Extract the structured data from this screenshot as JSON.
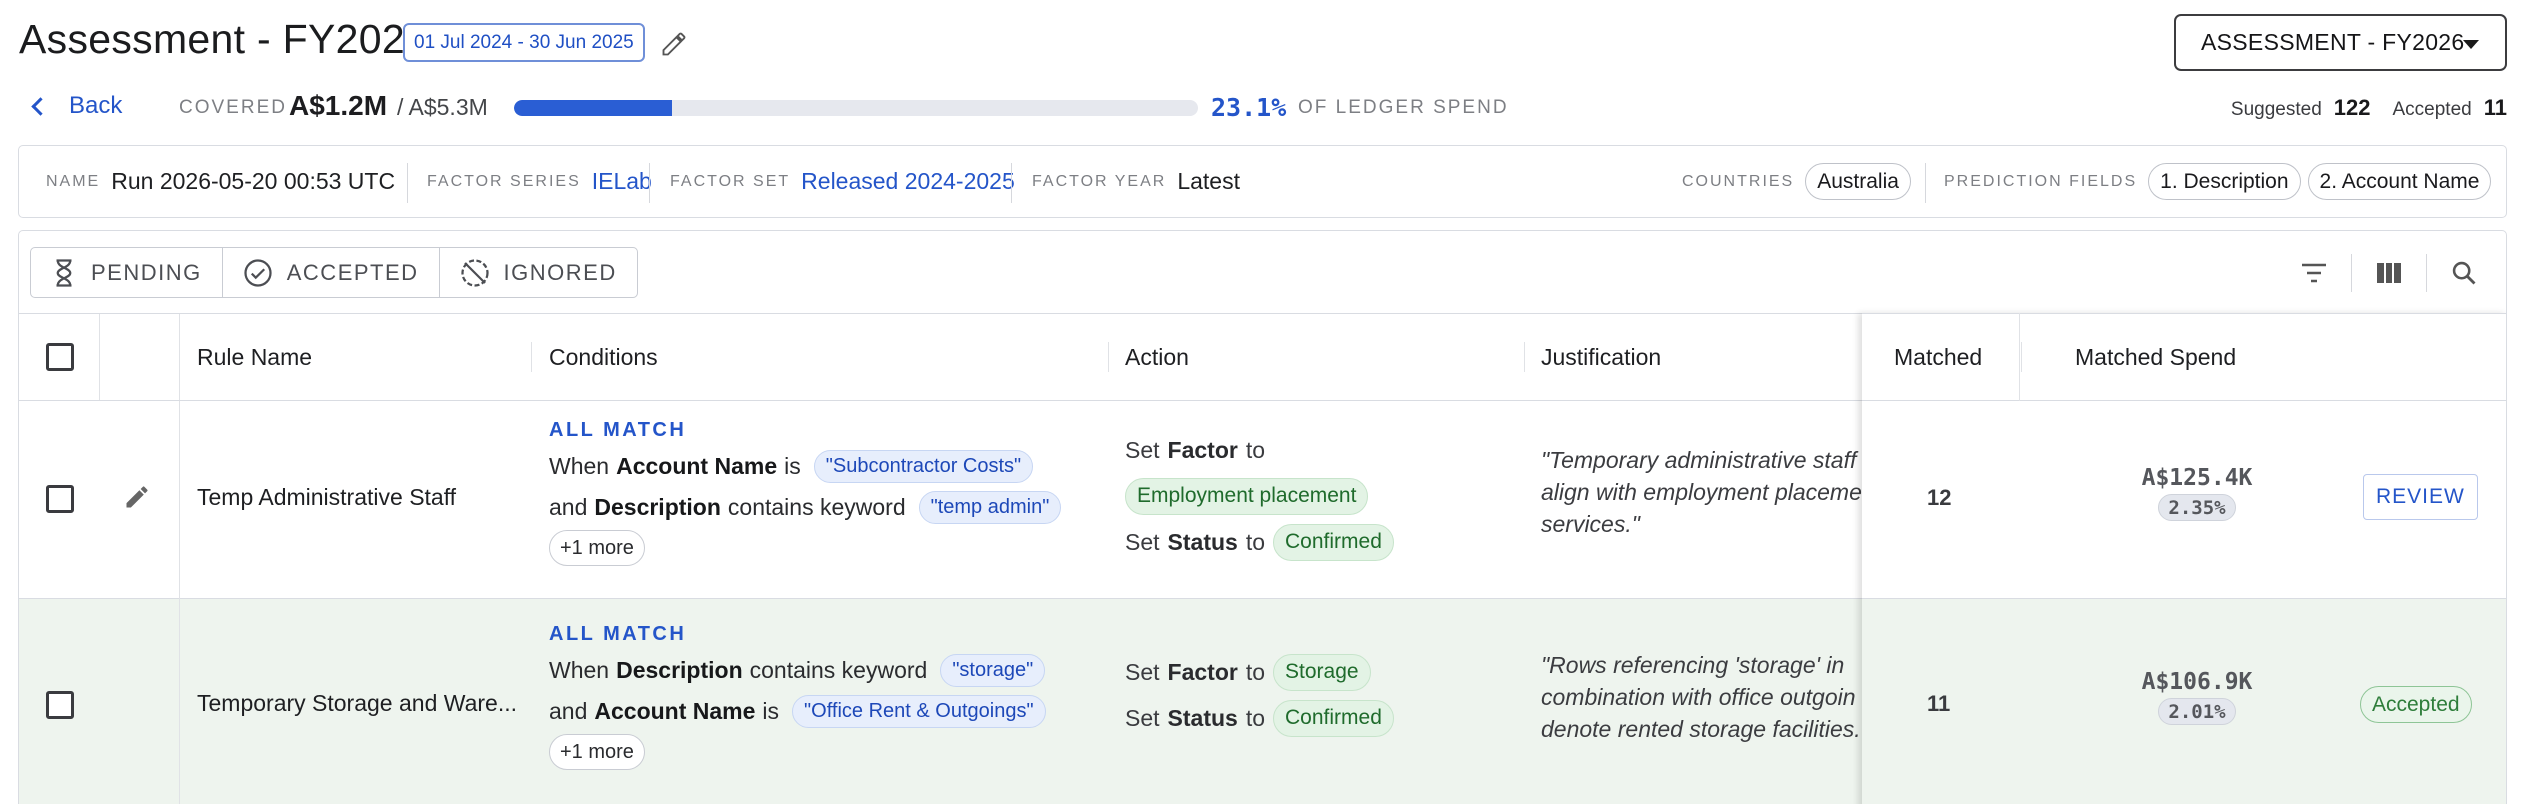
{
  "header": {
    "title": "Assessment - FY2026",
    "date_range": "01 Jul 2024 - 30 Jun 2025",
    "assessment_select": "ASSESSMENT - FY2026"
  },
  "summary": {
    "back_label": "Back",
    "covered_label": "COVERED",
    "covered_value": "A$1.2M",
    "covered_total": "/ A$5.3M",
    "progress_fraction": 0.231,
    "progress_color": "#2a5ed4",
    "percent": "23.1%",
    "percent_label": "OF LEDGER SPEND",
    "suggested_label": "Suggested",
    "suggested_count": "122",
    "accepted_label": "Accepted",
    "accepted_count": "11"
  },
  "run_info": {
    "name_label": "NAME",
    "name_value": "Run 2026-05-20 00:53 UTC",
    "factor_series_label": "FACTOR SERIES",
    "factor_series_value": "IELab",
    "factor_set_label": "FACTOR SET",
    "factor_set_value": "Released 2024-2025",
    "factor_year_label": "FACTOR YEAR",
    "factor_year_value": "Latest",
    "countries_label": "COUNTRIES",
    "countries": [
      "Australia"
    ],
    "prediction_fields_label": "PREDICTION FIELDS",
    "prediction_fields": [
      "1. Description",
      "2. Account Name"
    ]
  },
  "filter_tabs": [
    {
      "label": "PENDING",
      "icon": "hourglass-icon"
    },
    {
      "label": "ACCEPTED",
      "icon": "check-circle-icon"
    },
    {
      "label": "IGNORED",
      "icon": "ignore-circle-icon"
    }
  ],
  "toolbar": {
    "icons": [
      "filter-icon",
      "columns-icon",
      "search-icon"
    ]
  },
  "table": {
    "columns": [
      "Rule Name",
      "Conditions",
      "Action",
      "Justification",
      "Matched",
      "Matched Spend"
    ],
    "rows": [
      {
        "rule_name": "Temp Administrative Staff",
        "match_mode": "ALL MATCH",
        "conditions": [
          {
            "prefix": "When",
            "field": "Account Name",
            "op": "is",
            "value": "\"Subcontractor Costs\""
          },
          {
            "prefix": "and",
            "field": "Description",
            "op": "contains keyword",
            "value": "\"temp admin\""
          }
        ],
        "more": "+1 more",
        "actions": [
          {
            "prefix": "Set",
            "field": "Factor",
            "to": "to",
            "value": "Employment placement"
          },
          {
            "prefix": "Set",
            "field": "Status",
            "to": "to",
            "value": "Confirmed"
          }
        ],
        "justification": [
          "\"Temporary administrative staff",
          "align with employment placeme",
          "services.\""
        ],
        "matched": "12",
        "matched_spend": "A$125.4K",
        "spend_pct": "2.35%",
        "status_action": "REVIEW"
      },
      {
        "rule_name": "Temporary Storage and Ware...",
        "match_mode": "ALL MATCH",
        "conditions": [
          {
            "prefix": "When",
            "field": "Description",
            "op": "contains keyword",
            "value": "\"storage\""
          },
          {
            "prefix": "and",
            "field": "Account Name",
            "op": "is",
            "value": "\"Office Rent & Outgoings\""
          }
        ],
        "more": "+1 more",
        "actions": [
          {
            "prefix": "Set",
            "field": "Factor",
            "to": "to",
            "value": "Storage"
          },
          {
            "prefix": "Set",
            "field": "Status",
            "to": "to",
            "value": "Confirmed"
          }
        ],
        "justification": [
          "\"Rows referencing 'storage' in",
          "combination with office outgoin",
          "denote rented storage facilities."
        ],
        "matched": "11",
        "matched_spend": "A$106.9K",
        "spend_pct": "2.01%",
        "status_action": "Accepted"
      }
    ]
  }
}
